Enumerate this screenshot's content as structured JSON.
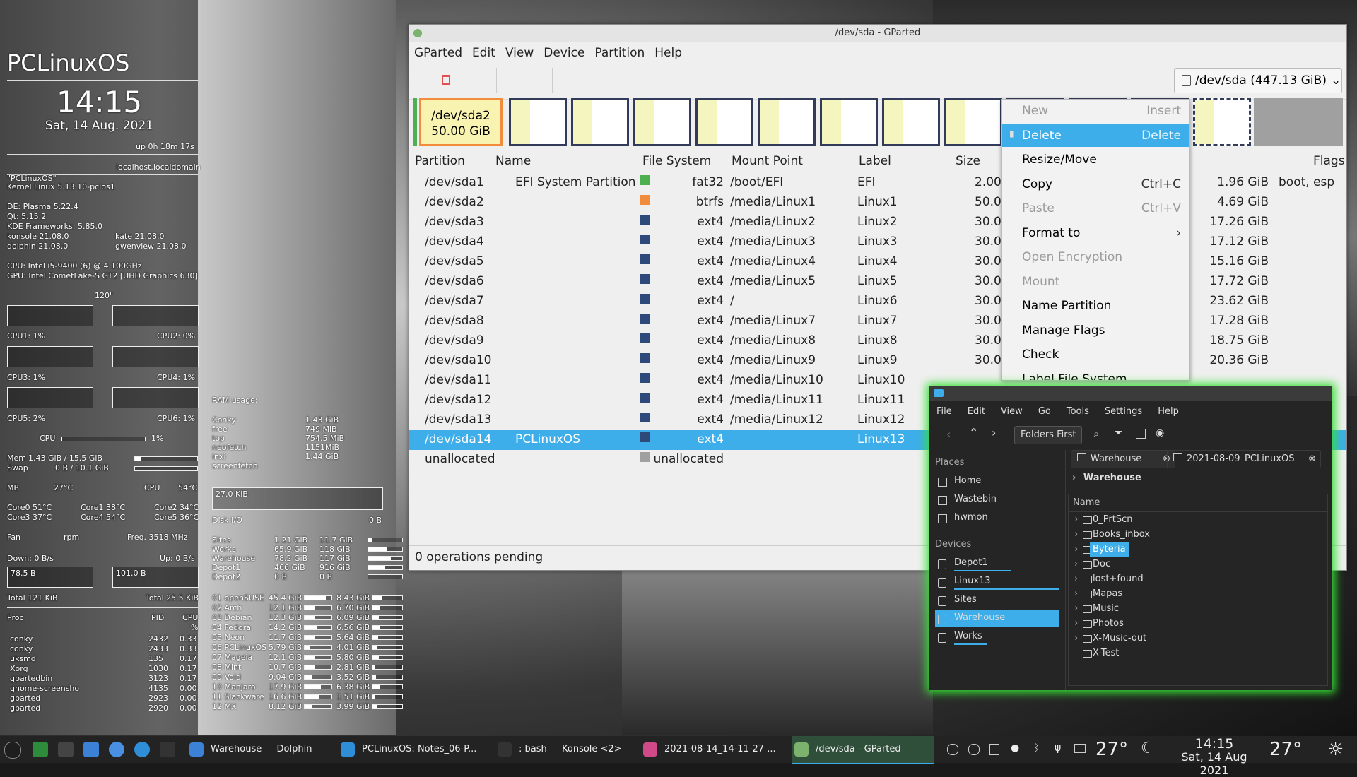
{
  "conky": {
    "distro": "PCLinuxOS",
    "time": "14:15",
    "date": "Sat, 14 Aug. 2021",
    "uptime": "up  0h 18m 17s",
    "host": "localhost.localdomain",
    "name": "\"PCLinuxOS\"",
    "kernel": "Kernel Linux 5.13.10-pclos1",
    "de": "DE: Plasma 5.22.4",
    "qt": "Qt: 5.15.2",
    "kf": "KDE Frameworks: 5.85.0",
    "konsole": "konsole 21.08.0",
    "kate": "kate 21.08.0",
    "dolphin": "dolphin 21.08.0",
    "gwenview": "gwenview 21.08.0",
    "cpu_model": "CPU: Intel i5-9400 (6) @ 4.100GHz",
    "gpu_model": "GPU: Intel CometLake-S GT2 [UHD Graphics 630]",
    "refresh": "120\"",
    "cpu1": "CPU1: 1%",
    "cpu2": "CPU2: 0%",
    "cpu3": "CPU3: 1%",
    "cpu4": "CPU4: 1%",
    "cpu5": "CPU5: 2%",
    "cpu6": "CPU6: 1%",
    "cpu_label": "CPU",
    "cpu_pct": "1%",
    "cpu_level": 0.01,
    "mem": "Mem",
    "mem_val": "1.43 GiB / 15.5 GiB",
    "mem_level": 0.09,
    "swap": "Swap",
    "swap_val": "0 B / 10.1 GiB",
    "swap_level": 0.0,
    "mb": "MB",
    "mb_temp": "27°C",
    "cpu_t": "CPU",
    "cpu_temp": "54°C",
    "core0": "Core0  51°C",
    "core1": "Core1  38°C",
    "core2": "Core2  34°C",
    "core3": "Core3  37°C",
    "core4": "Core4  54°C",
    "core5": "Core5  36°C",
    "fan": "Fan",
    "rpm": "rpm",
    "freq": "Freq.  3518   MHz",
    "down": "Down: 0 B/s",
    "up": "Up: 0 B/s",
    "down_scale": "78.5 B",
    "up_scale": "101.0 B",
    "total_down": "Total 121 KiB",
    "total_up": "Total 25.5 KiB",
    "ram_title": "RAM usage:",
    "ram_items": [
      {
        "n": "Conky",
        "v": "1.43 GiB"
      },
      {
        "n": "free",
        "v": "749    MiB"
      },
      {
        "n": "top",
        "v": "754.5  MiB"
      },
      {
        "n": "neofetch",
        "v": "1151MiB"
      },
      {
        "n": "inxi",
        "v": "1.44 GiB"
      },
      {
        "n": "screenfetch",
        "v": ""
      }
    ],
    "disk_scale": "27.0 KiB",
    "disk_io": "Disk I/O",
    "disk_io_val": "0 B",
    "disks": [
      {
        "n": "Sites",
        "u": "1.21 GiB",
        "t": "11.7 GiB",
        "l": 0.1
      },
      {
        "n": "Works",
        "u": "65.9 GiB",
        "t": "118 GiB",
        "l": 0.56
      },
      {
        "n": "Warehouse",
        "u": "78.2 GiB",
        "t": "117 GiB",
        "l": 0.67
      },
      {
        "n": "Depot1",
        "u": "466 GiB",
        "t": "916 GiB",
        "l": 0.51
      },
      {
        "n": "Depot2",
        "u": "0 B",
        "t": "0 B",
        "l": 0.0
      }
    ],
    "parts": [
      {
        "n": "01 openSUSE",
        "a": "45.4 GiB",
        "b": "8.43 GiB",
        "la": 0.8,
        "lb": 0.3
      },
      {
        "n": "02 Arch",
        "a": "12.1 GiB",
        "b": "6.70 GiB",
        "la": 0.4,
        "lb": 0.25
      },
      {
        "n": "03 Debian",
        "a": "12.3 GiB",
        "b": "6.09 GiB",
        "la": 0.4,
        "lb": 0.22
      },
      {
        "n": "04 Fedora",
        "a": "14.2 GiB",
        "b": "6.56 GiB",
        "la": 0.45,
        "lb": 0.24
      },
      {
        "n": "05 Neon",
        "a": "11.7 GiB",
        "b": "5.64 GiB",
        "la": 0.39,
        "lb": 0.2
      },
      {
        "n": "06 PCLinuxOS",
        "a": "5.79 GiB",
        "b": "4.01 GiB",
        "la": 0.2,
        "lb": 0.15
      },
      {
        "n": "07 Mageia",
        "a": "12.1 GiB",
        "b": "5.80 GiB",
        "la": 0.4,
        "lb": 0.21
      },
      {
        "n": "08 Mint",
        "a": "10.7 GiB",
        "b": "2.81 GiB",
        "la": 0.36,
        "lb": 0.1
      },
      {
        "n": "09 Void",
        "a": "9.04 GiB",
        "b": "3.52 GiB",
        "la": 0.3,
        "lb": 0.13
      },
      {
        "n": "10 Manjaro",
        "a": "17.9 GiB",
        "b": "6.38 GiB",
        "la": 0.6,
        "lb": 0.23
      },
      {
        "n": "11 Slackware",
        "a": "16.6 GiB",
        "b": "1.51 GiB",
        "la": 0.55,
        "lb": 0.06
      },
      {
        "n": "12 MX",
        "a": "8.12 GiB",
        "b": "3.99 GiB",
        "la": 0.27,
        "lb": 0.15
      }
    ],
    "proc_title": "Proc",
    "pid_title": "PID",
    "cpu_title": "CPU",
    "pct": "%",
    "procs": [
      {
        "n": "conky",
        "p": "2432",
        "c": "0.33"
      },
      {
        "n": "conky",
        "p": "2433",
        "c": "0.33"
      },
      {
        "n": "uksmd",
        "p": "135",
        "c": "0.17"
      },
      {
        "n": "Xorg",
        "p": "1030",
        "c": "0.17"
      },
      {
        "n": "gpartedbin",
        "p": "3123",
        "c": "0.17"
      },
      {
        "n": "gnome-screensho",
        "p": "4135",
        "c": "0.00"
      },
      {
        "n": "gparted",
        "p": "2923",
        "c": "0.00"
      },
      {
        "n": "gparted",
        "p": "2920",
        "c": "0.00"
      }
    ]
  },
  "gparted": {
    "title": "/dev/sda - GParted",
    "menu": [
      "GParted",
      "Edit",
      "View",
      "Device",
      "Partition",
      "Help"
    ],
    "device": "/dev/sda (447.13 GiB)",
    "selected_block_name": "/dev/sda2",
    "selected_block_size": "50.00 GiB",
    "columns": [
      "Partition",
      "Name",
      "File System",
      "Mount Point",
      "Label",
      "Size",
      "Unused",
      "Flags"
    ],
    "rows": [
      {
        "p": "/dev/sda1",
        "n": "EFI System Partition",
        "fs": "fat32",
        "c": "#4caf50",
        "m": "/boot/EFI",
        "l": "EFI",
        "s": "2.00",
        "u": "1.96 GiB",
        "f": "boot, esp"
      },
      {
        "p": "/dev/sda2",
        "n": "",
        "fs": "btrfs",
        "c": "#f08c3c",
        "m": "/media/Linux1",
        "l": "Linux1",
        "s": "50.00",
        "u": "4.69 GiB",
        "f": ""
      },
      {
        "p": "/dev/sda3",
        "n": "",
        "fs": "ext4",
        "c": "#2d4a7a",
        "m": "/media/Linux2",
        "l": "Linux2",
        "s": "30.00",
        "u": "17.26 GiB",
        "f": ""
      },
      {
        "p": "/dev/sda4",
        "n": "",
        "fs": "ext4",
        "c": "#2d4a7a",
        "m": "/media/Linux3",
        "l": "Linux3",
        "s": "30.00",
        "u": "17.12 GiB",
        "f": ""
      },
      {
        "p": "/dev/sda5",
        "n": "",
        "fs": "ext4",
        "c": "#2d4a7a",
        "m": "/media/Linux4",
        "l": "Linux4",
        "s": "30.00",
        "u": "15.16 GiB",
        "f": ""
      },
      {
        "p": "/dev/sda6",
        "n": "",
        "fs": "ext4",
        "c": "#2d4a7a",
        "m": "/media/Linux5",
        "l": "Linux5",
        "s": "30.00",
        "u": "17.72 GiB",
        "f": ""
      },
      {
        "p": "/dev/sda7",
        "n": "",
        "fs": "ext4",
        "c": "#2d4a7a",
        "m": "/",
        "l": "Linux6",
        "s": "30.00",
        "u": "23.62 GiB",
        "f": ""
      },
      {
        "p": "/dev/sda8",
        "n": "",
        "fs": "ext4",
        "c": "#2d4a7a",
        "m": "/media/Linux7",
        "l": "Linux7",
        "s": "30.00",
        "u": "17.28 GiB",
        "f": ""
      },
      {
        "p": "/dev/sda9",
        "n": "",
        "fs": "ext4",
        "c": "#2d4a7a",
        "m": "/media/Linux8",
        "l": "Linux8",
        "s": "30.00",
        "u": "18.75 GiB",
        "f": ""
      },
      {
        "p": "/dev/sda10",
        "n": "",
        "fs": "ext4",
        "c": "#2d4a7a",
        "m": "/media/Linux9",
        "l": "Linux9",
        "s": "30.00",
        "u": "20.36 GiB",
        "f": ""
      },
      {
        "p": "/dev/sda11",
        "n": "",
        "fs": "ext4",
        "c": "#2d4a7a",
        "m": "/media/Linux10",
        "l": "Linux10",
        "s": "",
        "u": "",
        "f": ""
      },
      {
        "p": "/dev/sda12",
        "n": "",
        "fs": "ext4",
        "c": "#2d4a7a",
        "m": "/media/Linux11",
        "l": "Linux11",
        "s": "",
        "u": "",
        "f": ""
      },
      {
        "p": "/dev/sda13",
        "n": "",
        "fs": "ext4",
        "c": "#2d4a7a",
        "m": "/media/Linux12",
        "l": "Linux12",
        "s": "",
        "u": "",
        "f": ""
      },
      {
        "p": "/dev/sda14",
        "n": "PCLinuxOS",
        "fs": "ext4",
        "c": "#2d4a7a",
        "m": "",
        "l": "Linux13",
        "s": "",
        "u": "",
        "f": ""
      },
      {
        "p": "unallocated",
        "n": "",
        "fs": "unallocated",
        "c": "#a0a0a0",
        "m": "",
        "l": "",
        "s": "",
        "u": "",
        "f": ""
      }
    ],
    "status": "0 operations pending"
  },
  "context_menu": [
    {
      "label": "New",
      "key": "Insert",
      "state": "disabled"
    },
    {
      "label": "Delete",
      "key": "Delete",
      "state": "highlighted"
    },
    {
      "label": "Resize/Move",
      "key": "",
      "state": "normal"
    },
    {
      "label": "Copy",
      "key": "Ctrl+C",
      "state": "normal"
    },
    {
      "label": "Paste",
      "key": "Ctrl+V",
      "state": "disabled"
    },
    {
      "label": "Format to",
      "key": "›",
      "state": "normal"
    },
    {
      "label": "Open Encryption",
      "key": "",
      "state": "disabled"
    },
    {
      "label": "Mount",
      "key": "",
      "state": "disabled"
    },
    {
      "label": "Name Partition",
      "key": "",
      "state": "normal"
    },
    {
      "label": "Manage Flags",
      "key": "",
      "state": "normal"
    },
    {
      "label": "Check",
      "key": "",
      "state": "normal"
    },
    {
      "label": "Label File System",
      "key": "",
      "state": "normal"
    }
  ],
  "dolphin": {
    "menu": [
      "File",
      "Edit",
      "View",
      "Go",
      "Tools",
      "Settings",
      "Help"
    ],
    "folders_first": "Folders First",
    "places_caption": "Places",
    "places": [
      "Home",
      "Wastebin",
      "hwmon"
    ],
    "devices_caption": "Devices",
    "devices": [
      "Depot1",
      "Linux13",
      "Sites",
      "Warehouse",
      "Works"
    ],
    "tabs": [
      "Warehouse",
      "2021-08-09_PCLinuxOS"
    ],
    "breadcrumb": "Warehouse",
    "name_header": "Name",
    "files": [
      "0_PrtScn",
      "Books_inbox",
      "Byteria",
      "Doc",
      "lost+found",
      "Mapas",
      "Music",
      "Photos",
      "X-Music-out",
      "X-Test"
    ]
  },
  "taskbar": {
    "tasks": [
      "Warehouse — Dolphin",
      "PCLinuxOS: Notes_06-P...",
      ": bash — Konsole <2>",
      "2021-08-14_14-11-27 ...",
      "/dev/sda - GParted"
    ],
    "temp": "27°",
    "clock_time": "14:15",
    "clock_date": "Sat, 14 Aug 2021",
    "weather_temp": "27°"
  }
}
